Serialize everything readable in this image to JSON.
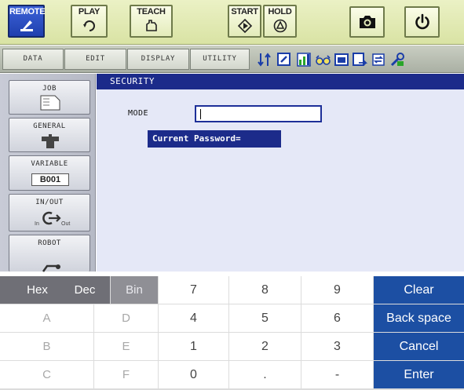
{
  "topbar": {
    "remote": "REMOTE",
    "play": "PLAY",
    "teach": "TEACH",
    "start": "START",
    "hold": "HOLD"
  },
  "menubar": {
    "data": "DATA",
    "edit": "EDIT",
    "display": "DISPLAY",
    "utility": "UTILITY"
  },
  "sidemenu": {
    "job": "JOB",
    "general": "GENERAL",
    "variable": "VARIABLE",
    "variable_value": "B001",
    "inout": "IN/OUT",
    "in_label": "In",
    "out_label": "Out",
    "robot": "ROBOT"
  },
  "screen": {
    "title": "SECURITY",
    "mode_label": "MODE",
    "mode_value": "",
    "password_prompt": "Current Password="
  },
  "keypad": {
    "modes": [
      "Hex",
      "Dec",
      "Bin"
    ],
    "letters": [
      "A",
      "B",
      "C",
      "D",
      "E",
      "F"
    ],
    "digits": [
      "7",
      "8",
      "9",
      "4",
      "5",
      "6",
      "1",
      "2",
      "3",
      "0",
      ".",
      "-"
    ],
    "actions": [
      "Clear",
      "Back space",
      "Cancel",
      "Enter"
    ]
  },
  "colors": {
    "accent_blue": "#1c2b8a",
    "action_blue": "#1c4fa3",
    "remote_active": "#2a4fc9"
  }
}
